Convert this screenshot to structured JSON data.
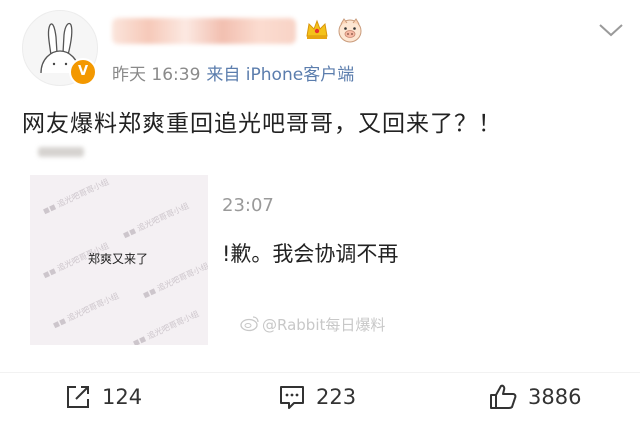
{
  "header": {
    "meta_time": "昨天 16:39",
    "meta_source": "来自 iPhone客户端",
    "verified_badge": "V",
    "icons": [
      "crown-icon",
      "pig-emoji-icon",
      "chevron-down-icon"
    ]
  },
  "post": {
    "text": "网友爆料郑爽重回追光吧哥哥，又回来了？！"
  },
  "embedded": {
    "caption": "郑爽又来了",
    "time": "23:07",
    "message": "!歉。我会协调不再",
    "watermark": "@Rabbit每日爆料"
  },
  "actions": {
    "repost_count": "124",
    "comment_count": "223",
    "like_count": "3886"
  },
  "colors": {
    "verified": "#f39800",
    "source_link": "#5b7dad"
  }
}
